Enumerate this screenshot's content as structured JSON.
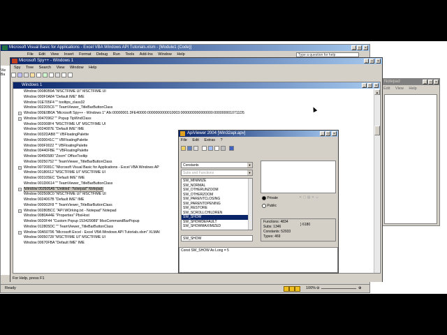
{
  "colors": {
    "desktop": "#ffffff",
    "title_active": "#0a246a",
    "title_active2": "#a6caf0",
    "title_inactive": "#808080",
    "face": "#d4d0c8",
    "highlight": "#0a246a"
  },
  "vba": {
    "title": "Microsoft Visual Basic for Applications - Excel VBA Windows API Tutorials.xlsm - [Module1 (Code)]",
    "menus": [
      "File",
      "Edit",
      "View",
      "Insert",
      "Format",
      "Debug",
      "Run",
      "Tools",
      "Add-Ins",
      "Window",
      "Help"
    ],
    "help_box": "Type a question for help",
    "status_text": "Ready",
    "zoom": "100%",
    "num": "NUM",
    "left_partial": [
      "Vie",
      "Ba"
    ]
  },
  "spy": {
    "title": "Microsoft Spy++ - Windows 1",
    "menus": [
      "Spy",
      "Tree",
      "Search",
      "View",
      "Window",
      "Help"
    ],
    "inner_title": "Windows 1",
    "status": "For Help, press F1",
    "rows": [
      {
        "t": "Window 00080B9A \"MSCTFIME UI\" MSCTFIME UI",
        "p": ""
      },
      {
        "t": "Window 000F0A84 \"Default IME\" IME",
        "p": ""
      },
      {
        "t": "Window 01E705F4 \"\" tooltips_class32",
        "p": ""
      },
      {
        "t": "Window 002205C6 \"\" TeamViewer_TitleBarButtonClass",
        "p": ""
      },
      {
        "t": "Window 000E0B0A \"Microsoft Spy++ - Windows 1\" Afx:00000001:3FE40000:0000000000010003:0000000000000000:0000000010711D5",
        "p": "+"
      },
      {
        "t": "Window 00470962 \"\" Popup TipWndClass",
        "p": "+"
      },
      {
        "t": "Window 002008F4 \"MSCTFIME UI\" MSCTFIME UI",
        "p": ""
      },
      {
        "t": "Window 0024087E \"Default IME\" IME",
        "p": ""
      },
      {
        "t": "Window 0032DAB8 \"\" VBFloatingPalette",
        "p": ""
      },
      {
        "t": "Window 0030041C \"\" VBFloatingPalette",
        "p": ""
      },
      {
        "t": "Window 000F0022 \"\" VBFloatingPalette",
        "p": ""
      },
      {
        "t": "Window 00440FBE \"\" VBFloatingPalette",
        "p": ""
      },
      {
        "t": "Window 00450580 \"Zoom\" OfficeTooltip",
        "p": ""
      },
      {
        "t": "Window 00250752 \"\" TeamViewer_TitleBarButtonClass",
        "p": ""
      },
      {
        "t": "Window 0072081C \"Microsoft Visual Basic for Applications - Excel VBA Windows AP",
        "p": "+"
      },
      {
        "t": "Window 00180612 \"MSCTFIME UI\" MSCTFIME UI",
        "p": ""
      },
      {
        "t": "Window 003105EC \"Default IME\" IME",
        "p": ""
      },
      {
        "t": "Window 001D0614 \"\" TeamViewer_TitleBarButtonClass",
        "p": ""
      },
      {
        "t": "Window 002606A6 \"Untitled - Notepad\" Notepad",
        "p": "+",
        "sel": true
      },
      {
        "t": "Window 002508C0 \"MSCTFIME UI\" MSCTFIME UI",
        "p": ""
      },
      {
        "t": "Window 0024067B \"Default IME\" IME",
        "p": ""
      },
      {
        "t": "Window 000002F8 \"\" TeamViewer_TitleBarButtonClass",
        "p": ""
      },
      {
        "t": "Window 00280BCC \"API WOrking.txt - Notepad\" Notepad",
        "p": "+"
      },
      {
        "t": "Window 0080A44E \"Properties\" PbsHost",
        "p": ""
      },
      {
        "t": "Window 0020F44 \"Custom Popup 153429089\" MsoCommandBarPopup",
        "p": ""
      },
      {
        "t": "Window 012805DC \"\" TeamViewer_TitleBarButtonClass",
        "p": ""
      },
      {
        "t": "Window 00A50796 \"Microsoft Excel - Excel VBA Windows API Tutorials.xlsm\" XLMAI",
        "p": "+"
      },
      {
        "t": "Window 00050728 \"MSCTFIME UI\" MSCTFIME UI",
        "p": ""
      },
      {
        "t": "Window 00670FBA \"Default IME\" IME",
        "p": ""
      }
    ]
  },
  "notepad": {
    "title": "Notepad",
    "menus": [
      "Edit",
      "View",
      "Help"
    ]
  },
  "api": {
    "title": "ApiViewer 2004 [Win32api.apv]",
    "menus": [
      "File",
      "Edit",
      "Extras",
      "?"
    ],
    "dropdown1": "Constants",
    "search_placeholder": "Subs and Functions",
    "items": [
      "SW_MINIMIZE",
      "SW_NORMAL",
      "SW_OTHERUNZOOM",
      "SW_OTHERZOOM",
      "SW_PARENTCLOSING",
      "SW_PARENTOPENING",
      "SW_RESTORE",
      "SW_SCROLLCHILDREN",
      "SW_SHOW",
      "SW_SHOWDEFAULT",
      "SW_SHOWMAXIMIZED"
    ],
    "selected_index": 8,
    "selected_value": "SW_SHOW",
    "private_label": "Private",
    "public_label": "Public",
    "functions": "Functions: 4834",
    "subs": "Subs: 1346",
    "constants": "Constants: 52933",
    "types": "Types: 469",
    "count": "} 6180",
    "declaration": "Const SW_SHOW As Long = 5"
  }
}
